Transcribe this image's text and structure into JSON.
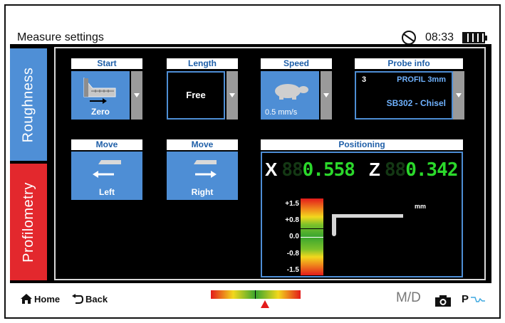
{
  "header": {
    "title": "Measure settings",
    "time": "08:33"
  },
  "tabs": [
    {
      "label": "Roughness"
    },
    {
      "label": "Profilometry"
    }
  ],
  "start": {
    "label": "Start",
    "value": "Zero"
  },
  "length": {
    "label": "Length",
    "value": "Free"
  },
  "speed": {
    "label": "Speed",
    "value": "0.5 mm/s"
  },
  "probe_info": {
    "label": "Probe info",
    "index": "3",
    "profile": "PROFIL 3mm",
    "probe": "SB302 - Chisel"
  },
  "move_left": {
    "label": "Move",
    "value": "Left"
  },
  "move_right": {
    "label": "Move",
    "value": "Right"
  },
  "positioning": {
    "label": "Positioning",
    "x_axis": "X",
    "x_ghost": "88",
    "x_value": "0.558",
    "z_axis": "Z",
    "z_ghost": "88",
    "z_value": "0.342",
    "unit": "mm",
    "scale": [
      "+1.5",
      "+0.8",
      "0.0",
      "-0.8",
      "-1.5"
    ]
  },
  "footer": {
    "home": "Home",
    "back": "Back",
    "md": "M/D",
    "p": "P"
  },
  "colors": {
    "accent": "#4e8ed5",
    "active_tab": "#e3282d",
    "readout": "#2bd82b"
  }
}
